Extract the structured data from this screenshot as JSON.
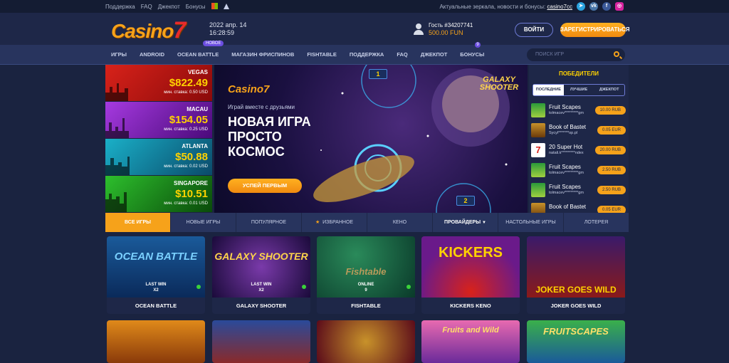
{
  "topstrip": {
    "links": [
      "Поддержка",
      "FAQ",
      "Джекпот",
      "Бонусы"
    ],
    "mirror_text": "Актуальные зеркала, новости и бонусы:",
    "mirror_link": "casino7cc"
  },
  "header": {
    "logo_text": "Casino",
    "logo_seven": "7",
    "date": "2022 апр. 14",
    "time": "16:28:59",
    "user_name": "Гость #34207741",
    "balance": "500.00 FUN",
    "login_label": "ВОЙТИ",
    "register_label": "ЗАРЕГИСТРИРОВАТЬСЯ"
  },
  "nav": {
    "items": [
      "ИГРЫ",
      "ANDROID",
      "OCEAN BATTLE",
      "МАГАЗИН ФРИСПИНОВ",
      "FISHTABLE",
      "ПОДДЕРЖКА",
      "FAQ",
      "ДЖЕКПОТ",
      "БОНУСЫ"
    ],
    "new_badge": "НОВОЕ",
    "bonus_badge": "9",
    "search_placeholder": "ПОИСК ИГР"
  },
  "jackpots": [
    {
      "name": "VEGAS",
      "amount": "$822.49",
      "min": "мин. ставка: 0.50 USD",
      "color": "#d8221a"
    },
    {
      "name": "MACAU",
      "amount": "$154.05",
      "min": "мин. ставка: 0.25 USD",
      "color": "#8a2be2"
    },
    {
      "name": "ATLANTA",
      "amount": "$50.88",
      "min": "мин. ставка: 0.02 USD",
      "color": "#1a9ab0"
    },
    {
      "name": "SINGAPORE",
      "amount": "$10.51",
      "min": "мин. ставка: 0.01 USD",
      "color": "#2da32d"
    }
  ],
  "banner": {
    "logo": "Casino7",
    "subtitle": "Играй вместе с друзьями",
    "headline": "НОВАЯ ИГРА ПРОСТО КОСМОС",
    "cta": "УСПЕЙ ПЕРВЫМ",
    "game_title": "GALAXY SHOOTER",
    "player1": "1",
    "player2": "2"
  },
  "winners": {
    "title": "ПОБЕДИТЕЛИ",
    "tabs": [
      "ПОСЛЕДНИЕ",
      "ЛУЧШИЕ",
      "ДЖЕКПОТ"
    ],
    "rows": [
      {
        "game": "Fruit Scapes",
        "user": "tolmacev*********gm",
        "amount": "10.00 RUB"
      },
      {
        "game": "Book of Bastet",
        "user": "Sycyl*******op.pl",
        "amount": "0.05 EUR"
      },
      {
        "game": "20 Super Hot",
        "user": "natali.k*********ndex",
        "amount": "20.00 RUB"
      },
      {
        "game": "Fruit Scapes",
        "user": "tolmacev*********gm",
        "amount": "2.50 RUB"
      },
      {
        "game": "Fruit Scapes",
        "user": "tolmacev*********gm",
        "amount": "2.50 RUB"
      },
      {
        "game": "Book of Bastet",
        "user": "",
        "amount": "0.05 EUR"
      }
    ]
  },
  "tabs": [
    "ВСЕ ИГРЫ",
    "НОВЫЕ ИГРЫ",
    "ПОПУЛЯРНОЕ",
    "ИЗБРАННОЕ",
    "КЕНО",
    "ПРОВАЙДЕРЫ",
    "НАСТОЛЬНЫЕ ИГРЫ",
    "ЛОТЕРЕЯ"
  ],
  "games": [
    {
      "name": "OCEAN BATTLE",
      "art": "OCEAN BATTLE",
      "status": "LAST WIN",
      "value": "X2"
    },
    {
      "name": "GALAXY SHOOTER",
      "art": "GALAXY SHOOTER",
      "status": "LAST WIN",
      "value": "X2"
    },
    {
      "name": "FISHTABLE",
      "art": "Fishtable",
      "status": "ONLINE",
      "value": "9"
    },
    {
      "name": "KICKERS KENO",
      "art": "KICKERS",
      "status": "",
      "value": ""
    },
    {
      "name": "JOKER GOES WILD",
      "art": "JOKER GOES WILD",
      "status": "",
      "value": ""
    }
  ],
  "games_row2": [
    "",
    "",
    "",
    "Fruits and Wild",
    "FRUITSCAPES"
  ]
}
